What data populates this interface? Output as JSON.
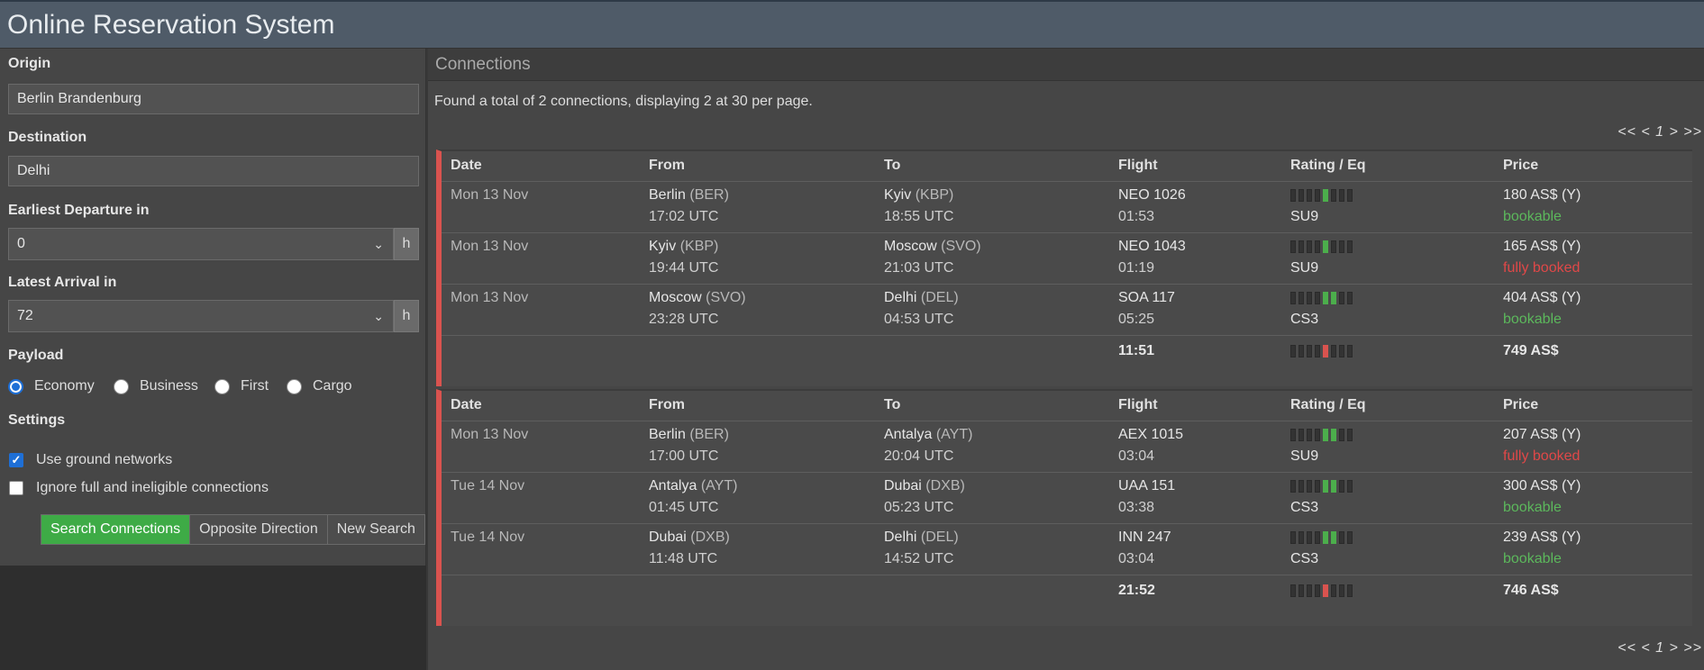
{
  "app": {
    "title": "Online Reservation System"
  },
  "form": {
    "origin_label": "Origin",
    "origin_value": "Berlin Brandenburg",
    "destination_label": "Destination",
    "destination_value": "Delhi",
    "earliest_label": "Earliest Departure in",
    "earliest_value": "0",
    "latest_label": "Latest Arrival in",
    "latest_value": "72",
    "hour_unit": "h",
    "payload_label": "Payload",
    "payload_options": [
      "Economy",
      "Business",
      "First",
      "Cargo"
    ],
    "payload_selected": "Economy",
    "settings_label": "Settings",
    "use_ground_label": "Use ground networks",
    "use_ground_checked": true,
    "ignore_full_label": "Ignore full and ineligible connections",
    "ignore_full_checked": false,
    "search_label": "Search Connections",
    "opposite_label": "Opposite Direction",
    "new_search_label": "New Search"
  },
  "results": {
    "panel_title": "Connections",
    "summary": "Found a total of 2 connections, displaying 2 at 30 per page.",
    "pager": "<< < 1 > >>",
    "headers": [
      "Date",
      "From",
      "To",
      "Flight",
      "Rating / Eq",
      "Price"
    ],
    "connections": [
      {
        "legs": [
          {
            "date": "Mon 13 Nov",
            "from_city": "Berlin",
            "from_code": "(BER)",
            "dep": "17:02 UTC",
            "to_city": "Kyiv",
            "to_code": "(KBP)",
            "arr": "18:55 UTC",
            "flight": "NEO 1026",
            "duration": "01:53",
            "rating": {
              "level": 5,
              "color": "green"
            },
            "equipment": "SU9",
            "price": "180 AS$ (Y)",
            "status": "bookable"
          },
          {
            "date": "Mon 13 Nov",
            "from_city": "Kyiv",
            "from_code": "(KBP)",
            "dep": "19:44 UTC",
            "to_city": "Moscow",
            "to_code": "(SVO)",
            "arr": "21:03 UTC",
            "flight": "NEO 1043",
            "duration": "01:19",
            "rating": {
              "level": 5,
              "color": "green"
            },
            "equipment": "SU9",
            "price": "165 AS$ (Y)",
            "status": "fully booked"
          },
          {
            "date": "Mon 13 Nov",
            "from_city": "Moscow",
            "from_code": "(SVO)",
            "dep": "23:28 UTC",
            "to_city": "Delhi",
            "to_code": "(DEL)",
            "arr": "04:53 UTC",
            "flight": "SOA 117",
            "duration": "05:25",
            "rating": {
              "level": 6,
              "color": "green"
            },
            "equipment": "CS3",
            "price": "404 AS$ (Y)",
            "status": "bookable"
          }
        ],
        "total_duration": "11:51",
        "total_rating": {
          "level": 4,
          "color": "red"
        },
        "total_price": "749 AS$"
      },
      {
        "legs": [
          {
            "date": "Mon 13 Nov",
            "from_city": "Berlin",
            "from_code": "(BER)",
            "dep": "17:00 UTC",
            "to_city": "Antalya",
            "to_code": "(AYT)",
            "arr": "20:04 UTC",
            "flight": "AEX 1015",
            "duration": "03:04",
            "rating": {
              "level": 6,
              "color": "green"
            },
            "equipment": "SU9",
            "price": "207 AS$ (Y)",
            "status": "fully booked"
          },
          {
            "date": "Tue 14 Nov",
            "from_city": "Antalya",
            "from_code": "(AYT)",
            "dep": "01:45 UTC",
            "to_city": "Dubai",
            "to_code": "(DXB)",
            "arr": "05:23 UTC",
            "flight": "UAA 151",
            "duration": "03:38",
            "rating": {
              "level": 6,
              "color": "green"
            },
            "equipment": "CS3",
            "price": "300 AS$ (Y)",
            "status": "bookable"
          },
          {
            "date": "Tue 14 Nov",
            "from_city": "Dubai",
            "from_code": "(DXB)",
            "dep": "11:48 UTC",
            "to_city": "Delhi",
            "to_code": "(DEL)",
            "arr": "14:52 UTC",
            "flight": "INN 247",
            "duration": "03:04",
            "rating": {
              "level": 6,
              "color": "green"
            },
            "equipment": "CS3",
            "price": "239 AS$ (Y)",
            "status": "bookable"
          }
        ],
        "total_duration": "21:52",
        "total_rating": {
          "level": 4,
          "color": "red"
        },
        "total_price": "746 AS$"
      }
    ]
  },
  "colors": {
    "accent_green": "#3eab46",
    "status_green": "#5cb85c",
    "status_red": "#e04848",
    "block_border": "#d9534f",
    "title_bar": "#4f5b68"
  }
}
